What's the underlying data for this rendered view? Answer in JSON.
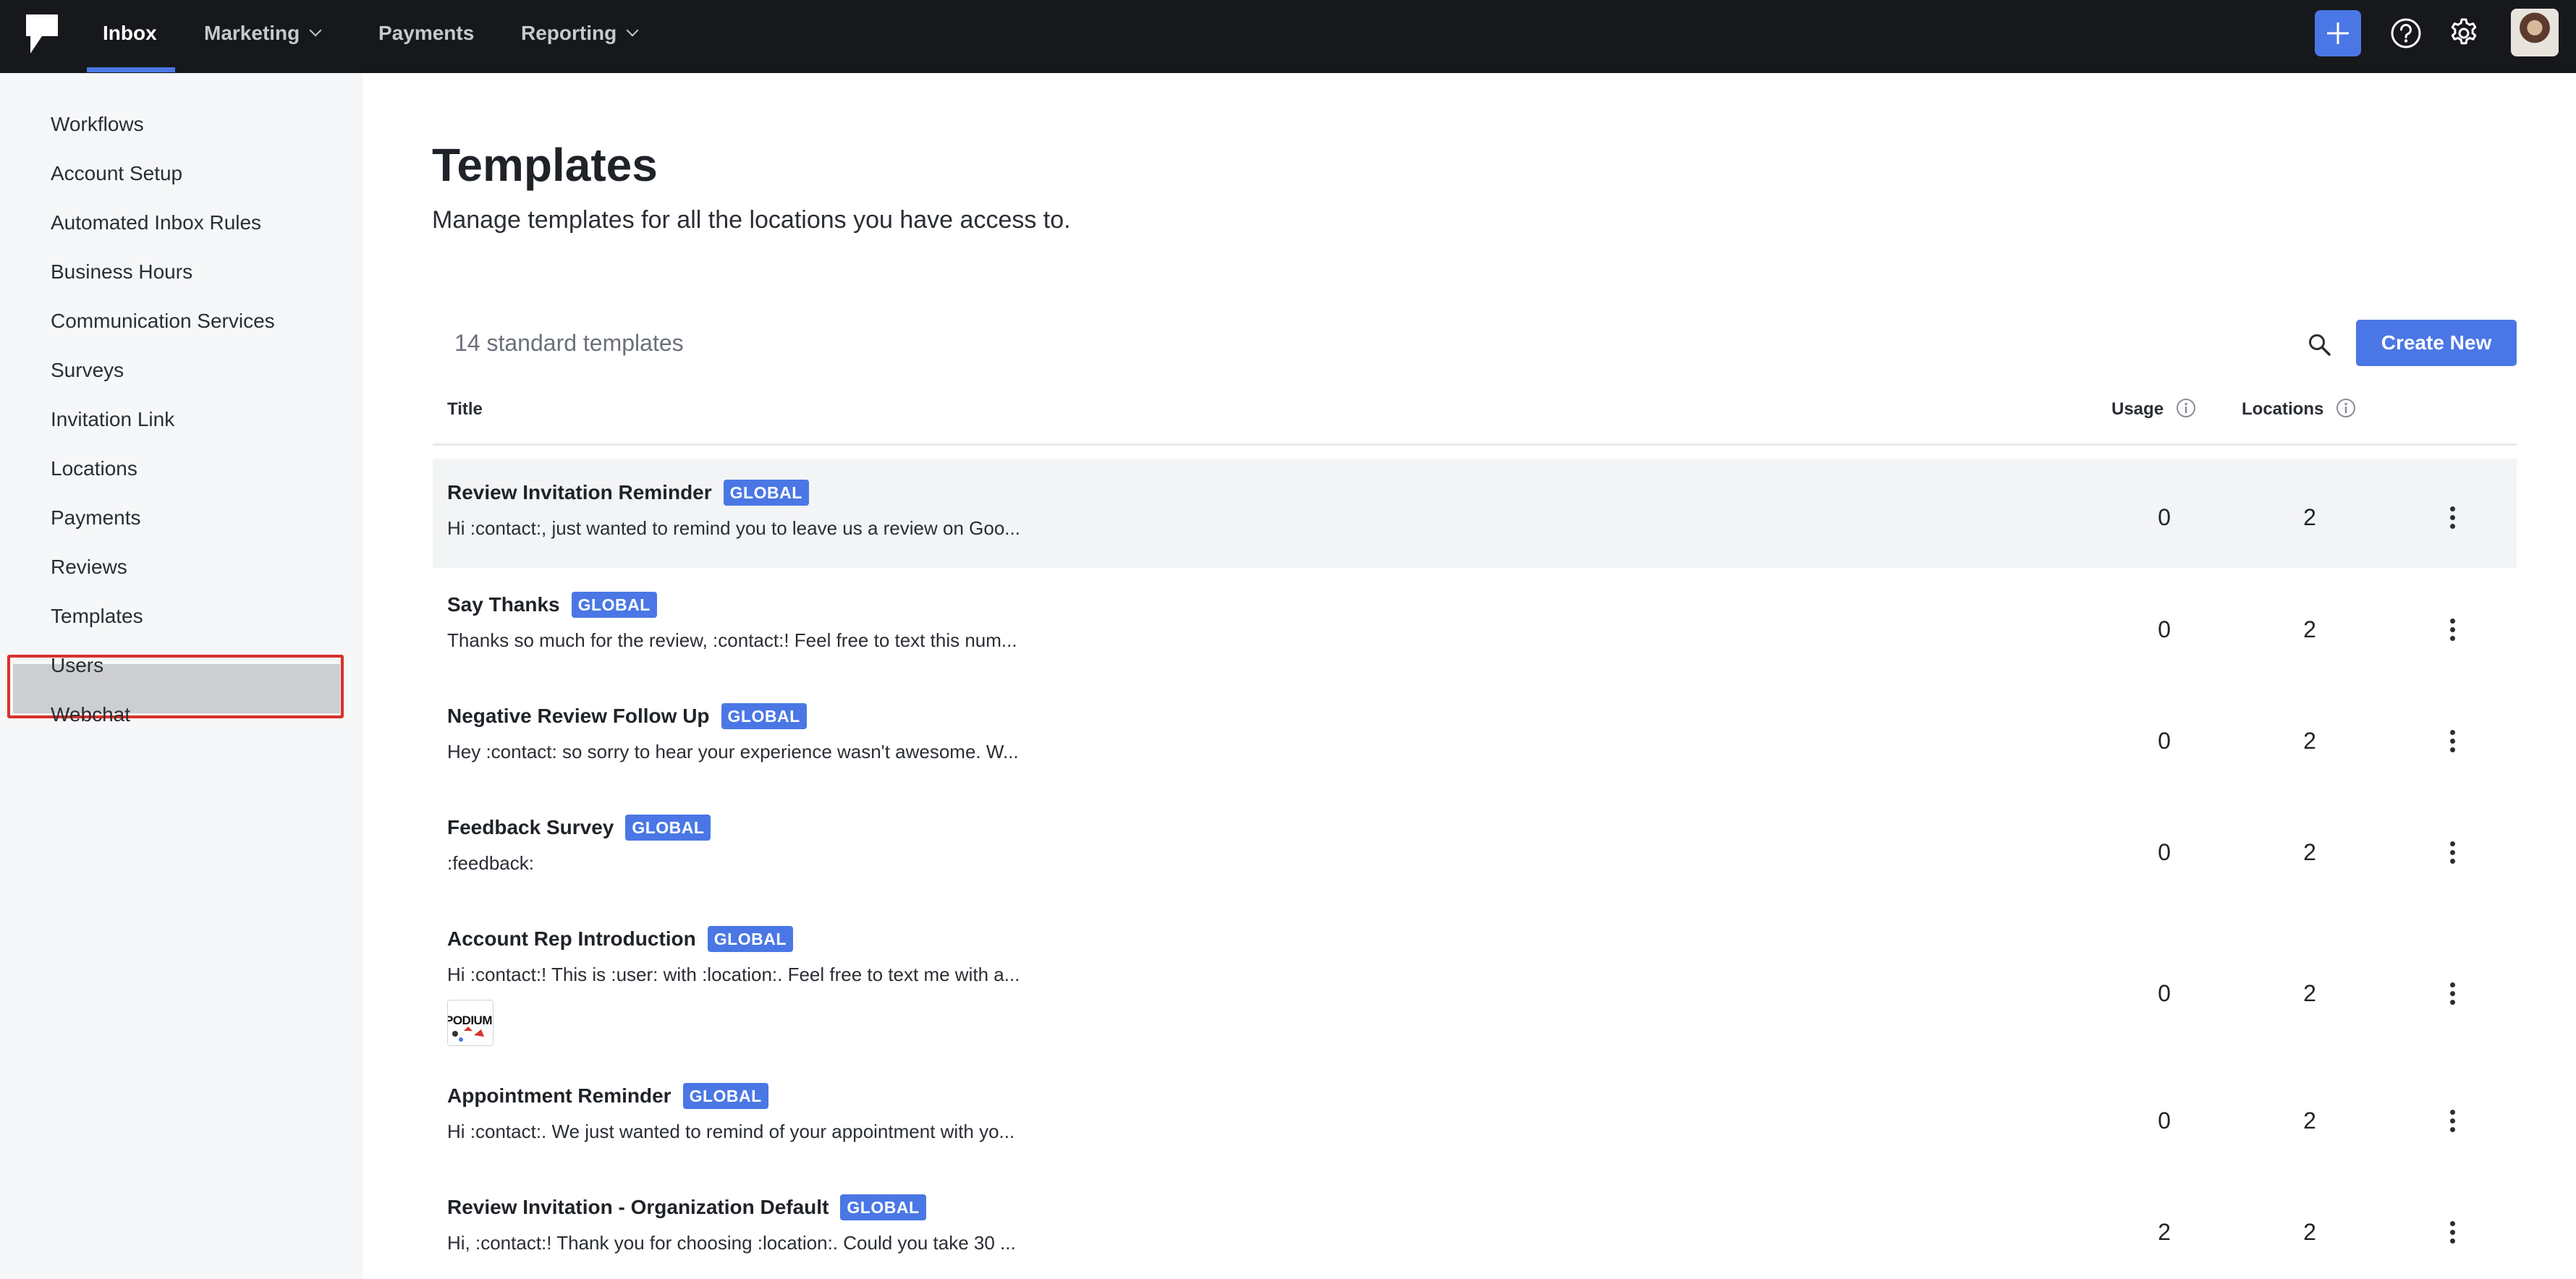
{
  "topnav": {
    "items": [
      {
        "label": "Inbox",
        "active": true,
        "dropdown": false
      },
      {
        "label": "Marketing",
        "active": false,
        "dropdown": true
      },
      {
        "label": "Payments",
        "active": false,
        "dropdown": false
      },
      {
        "label": "Reporting",
        "active": false,
        "dropdown": true
      }
    ],
    "icons": [
      "plus-icon",
      "help-icon",
      "gear-icon",
      "avatar"
    ],
    "accent_color": "#4a77e5",
    "bar_color": "#16181c"
  },
  "sidebar": {
    "items": [
      {
        "label": "Workflows"
      },
      {
        "label": "Account Setup"
      },
      {
        "label": "Automated Inbox Rules"
      },
      {
        "label": "Business Hours"
      },
      {
        "label": "Communication Services"
      },
      {
        "label": "Surveys"
      },
      {
        "label": "Invitation Link"
      },
      {
        "label": "Locations"
      },
      {
        "label": "Payments"
      },
      {
        "label": "Reviews"
      },
      {
        "label": "Templates",
        "active": true,
        "highlighted": true
      },
      {
        "label": "Users"
      },
      {
        "label": "Webchat"
      }
    ],
    "highlight_color": "#d9312b"
  },
  "main": {
    "title": "Templates",
    "subtitle": "Manage templates for all the locations you have access to.",
    "count_label": "14 standard templates",
    "create_button": "Create New",
    "columns": {
      "title": "Title",
      "usage": "Usage",
      "locations": "Locations"
    },
    "rows": [
      {
        "title": "Review Invitation Reminder",
        "badge": "GLOBAL",
        "body": "Hi :contact:, just wanted to remind you to leave us a review on Goo...",
        "usage": "0",
        "locations": "2",
        "hover": true
      },
      {
        "title": "Say Thanks",
        "badge": "GLOBAL",
        "body": "Thanks so much for the review, :contact:! Feel free to text this num...",
        "usage": "0",
        "locations": "2"
      },
      {
        "title": "Negative Review Follow Up",
        "badge": "GLOBAL",
        "body": "Hey :contact: so sorry to hear your experience wasn't awesome. W...",
        "usage": "0",
        "locations": "2"
      },
      {
        "title": "Feedback Survey",
        "badge": "GLOBAL",
        "body": ":feedback:",
        "usage": "0",
        "locations": "2"
      },
      {
        "title": "Account Rep Introduction",
        "badge": "GLOBAL",
        "body": "Hi :contact:! This is :user: with :location:. Feel free to text me with a...",
        "usage": "0",
        "locations": "2",
        "thumbnail_text": "PODIUM"
      },
      {
        "title": "Appointment Reminder",
        "badge": "GLOBAL",
        "body": "Hi :contact:. We just wanted to remind of your appointment with yo...",
        "usage": "0",
        "locations": "2"
      },
      {
        "title": "Review Invitation - Organization Default",
        "badge": "GLOBAL",
        "body": "Hi, :contact:! Thank you for choosing :location:. Could you take 30 ...",
        "usage": "2",
        "locations": "2"
      }
    ]
  }
}
